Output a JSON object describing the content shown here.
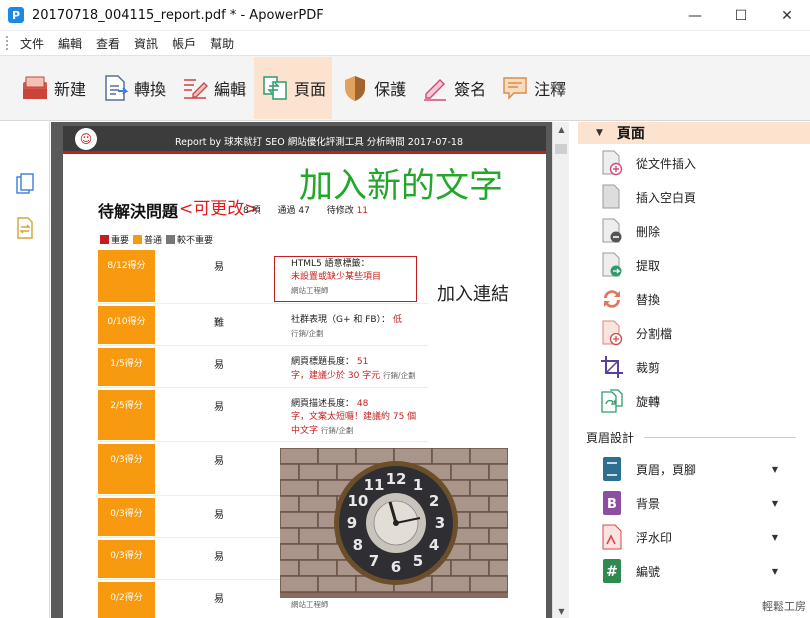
{
  "window": {
    "title": "20170718_004115_report.pdf * - ApowerPDF",
    "logo_letter": "P",
    "min": "—",
    "max": "☐",
    "close": "✕"
  },
  "menu": [
    "文件",
    "編輯",
    "查看",
    "資訊",
    "帳戶",
    "幫助"
  ],
  "toolbar": [
    {
      "label": "新建",
      "icon": "new-file-icon"
    },
    {
      "label": "轉換",
      "icon": "convert-icon"
    },
    {
      "label": "編輯",
      "icon": "edit-icon"
    },
    {
      "label": "頁面",
      "icon": "page-icon",
      "active": true
    },
    {
      "label": "保護",
      "icon": "shield-icon"
    },
    {
      "label": "簽名",
      "icon": "pen-icon"
    },
    {
      "label": "注釋",
      "icon": "comment-icon"
    }
  ],
  "document": {
    "header_text": "Report by 球來就打 SEO 網站優化評測工具  分析時間 2017-07-18",
    "header_logo": "☺",
    "big_text": "加入新的文字",
    "section_title": "待解決問題",
    "edit_label": "<可更改>",
    "counts": {
      "items_tail": "8 項",
      "pass_label": "通過",
      "pass_value": "47",
      "fix_label": "待修改",
      "fix_value": "11"
    },
    "legend": [
      {
        "label": "重要",
        "color": "#c41e1e"
      },
      {
        "label": "普通",
        "color": "#f79a0f"
      },
      {
        "label": "較不重要",
        "color": "#777777"
      }
    ],
    "link_text": "加入連結",
    "rows": [
      {
        "score": "8/12得分",
        "difficulty": "易",
        "title": "HTML5 語意標籤：",
        "highlight": "未設置或缺少某些項目",
        "sub": "網站工程師"
      },
      {
        "score": "0/10得分",
        "difficulty": "難",
        "title": "社群表現（G+ 和 FB）：",
        "highlight": "低",
        "sub": "行銷/企劃"
      },
      {
        "score": "1/5得分",
        "difficulty": "易",
        "title": "網頁標題長度：",
        "value": "51",
        "highlight": "字，建議少於 30 字元",
        "sub": "行銷/企劃"
      },
      {
        "score": "2/5得分",
        "difficulty": "易",
        "title": "網頁描述長度：",
        "value": "48",
        "highlight": "字，文案太短囉！建議約 75 個中文字",
        "sub": "行銷/企劃"
      },
      {
        "score": "0/3得分",
        "difficulty": "易"
      },
      {
        "score": "0/3得分",
        "difficulty": "易"
      },
      {
        "score": "0/3得分",
        "difficulty": "易"
      },
      {
        "score": "0/2得分",
        "difficulty": "易",
        "sub": "網站工程師"
      }
    ],
    "photo_clock_numbers": [
      "12",
      "1",
      "2",
      "3",
      "4",
      "5",
      "6",
      "7",
      "8",
      "9",
      "10",
      "11"
    ]
  },
  "right_panel": {
    "header": "頁面",
    "items": [
      {
        "label": "從文件插入",
        "icon": "insert-from-file-icon"
      },
      {
        "label": "插入空白頁",
        "icon": "insert-blank-page-icon"
      },
      {
        "label": "刪除",
        "icon": "delete-page-icon"
      },
      {
        "label": "提取",
        "icon": "extract-page-icon"
      },
      {
        "label": "替換",
        "icon": "replace-page-icon"
      },
      {
        "label": "分割檔",
        "icon": "split-file-icon"
      },
      {
        "label": "裁剪",
        "icon": "crop-icon"
      },
      {
        "label": "旋轉",
        "icon": "rotate-icon"
      }
    ],
    "section_label": "頁眉設計",
    "design_items": [
      {
        "label": "頁眉，頁腳",
        "icon": "header-footer-icon"
      },
      {
        "label": "背景",
        "icon": "background-icon"
      },
      {
        "label": "浮水印",
        "icon": "watermark-icon"
      },
      {
        "label": "編號",
        "icon": "numbering-icon"
      }
    ],
    "watermark": "輕鬆工房"
  },
  "colors": {
    "accent": "#fbe3cf",
    "score_orange": "#f79a0f",
    "important_red": "#c41e1e",
    "green_text": "#22a829"
  }
}
